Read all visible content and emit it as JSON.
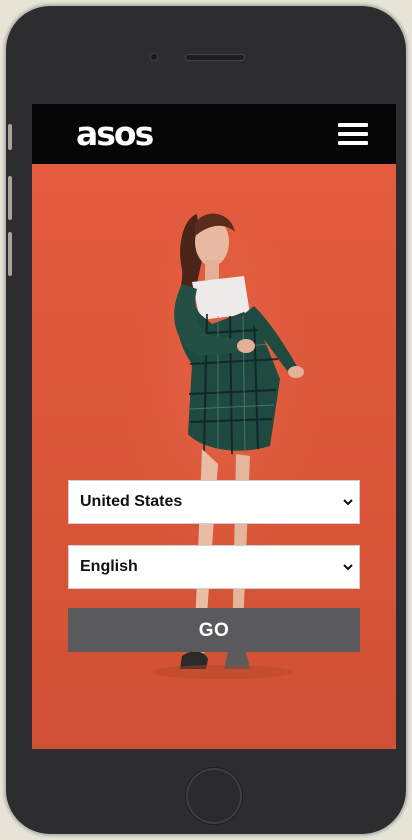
{
  "header": {
    "logo_text": "asos",
    "menu_icon": "hamburger-menu-icon"
  },
  "form": {
    "country": {
      "selected": "United States"
    },
    "language": {
      "selected": "English"
    },
    "go_label": "GO"
  },
  "colors": {
    "hero_background": "#d8573a",
    "header_background": "#050505",
    "go_button": "#5a5a5c",
    "phone_body": "#2d2d2f"
  }
}
